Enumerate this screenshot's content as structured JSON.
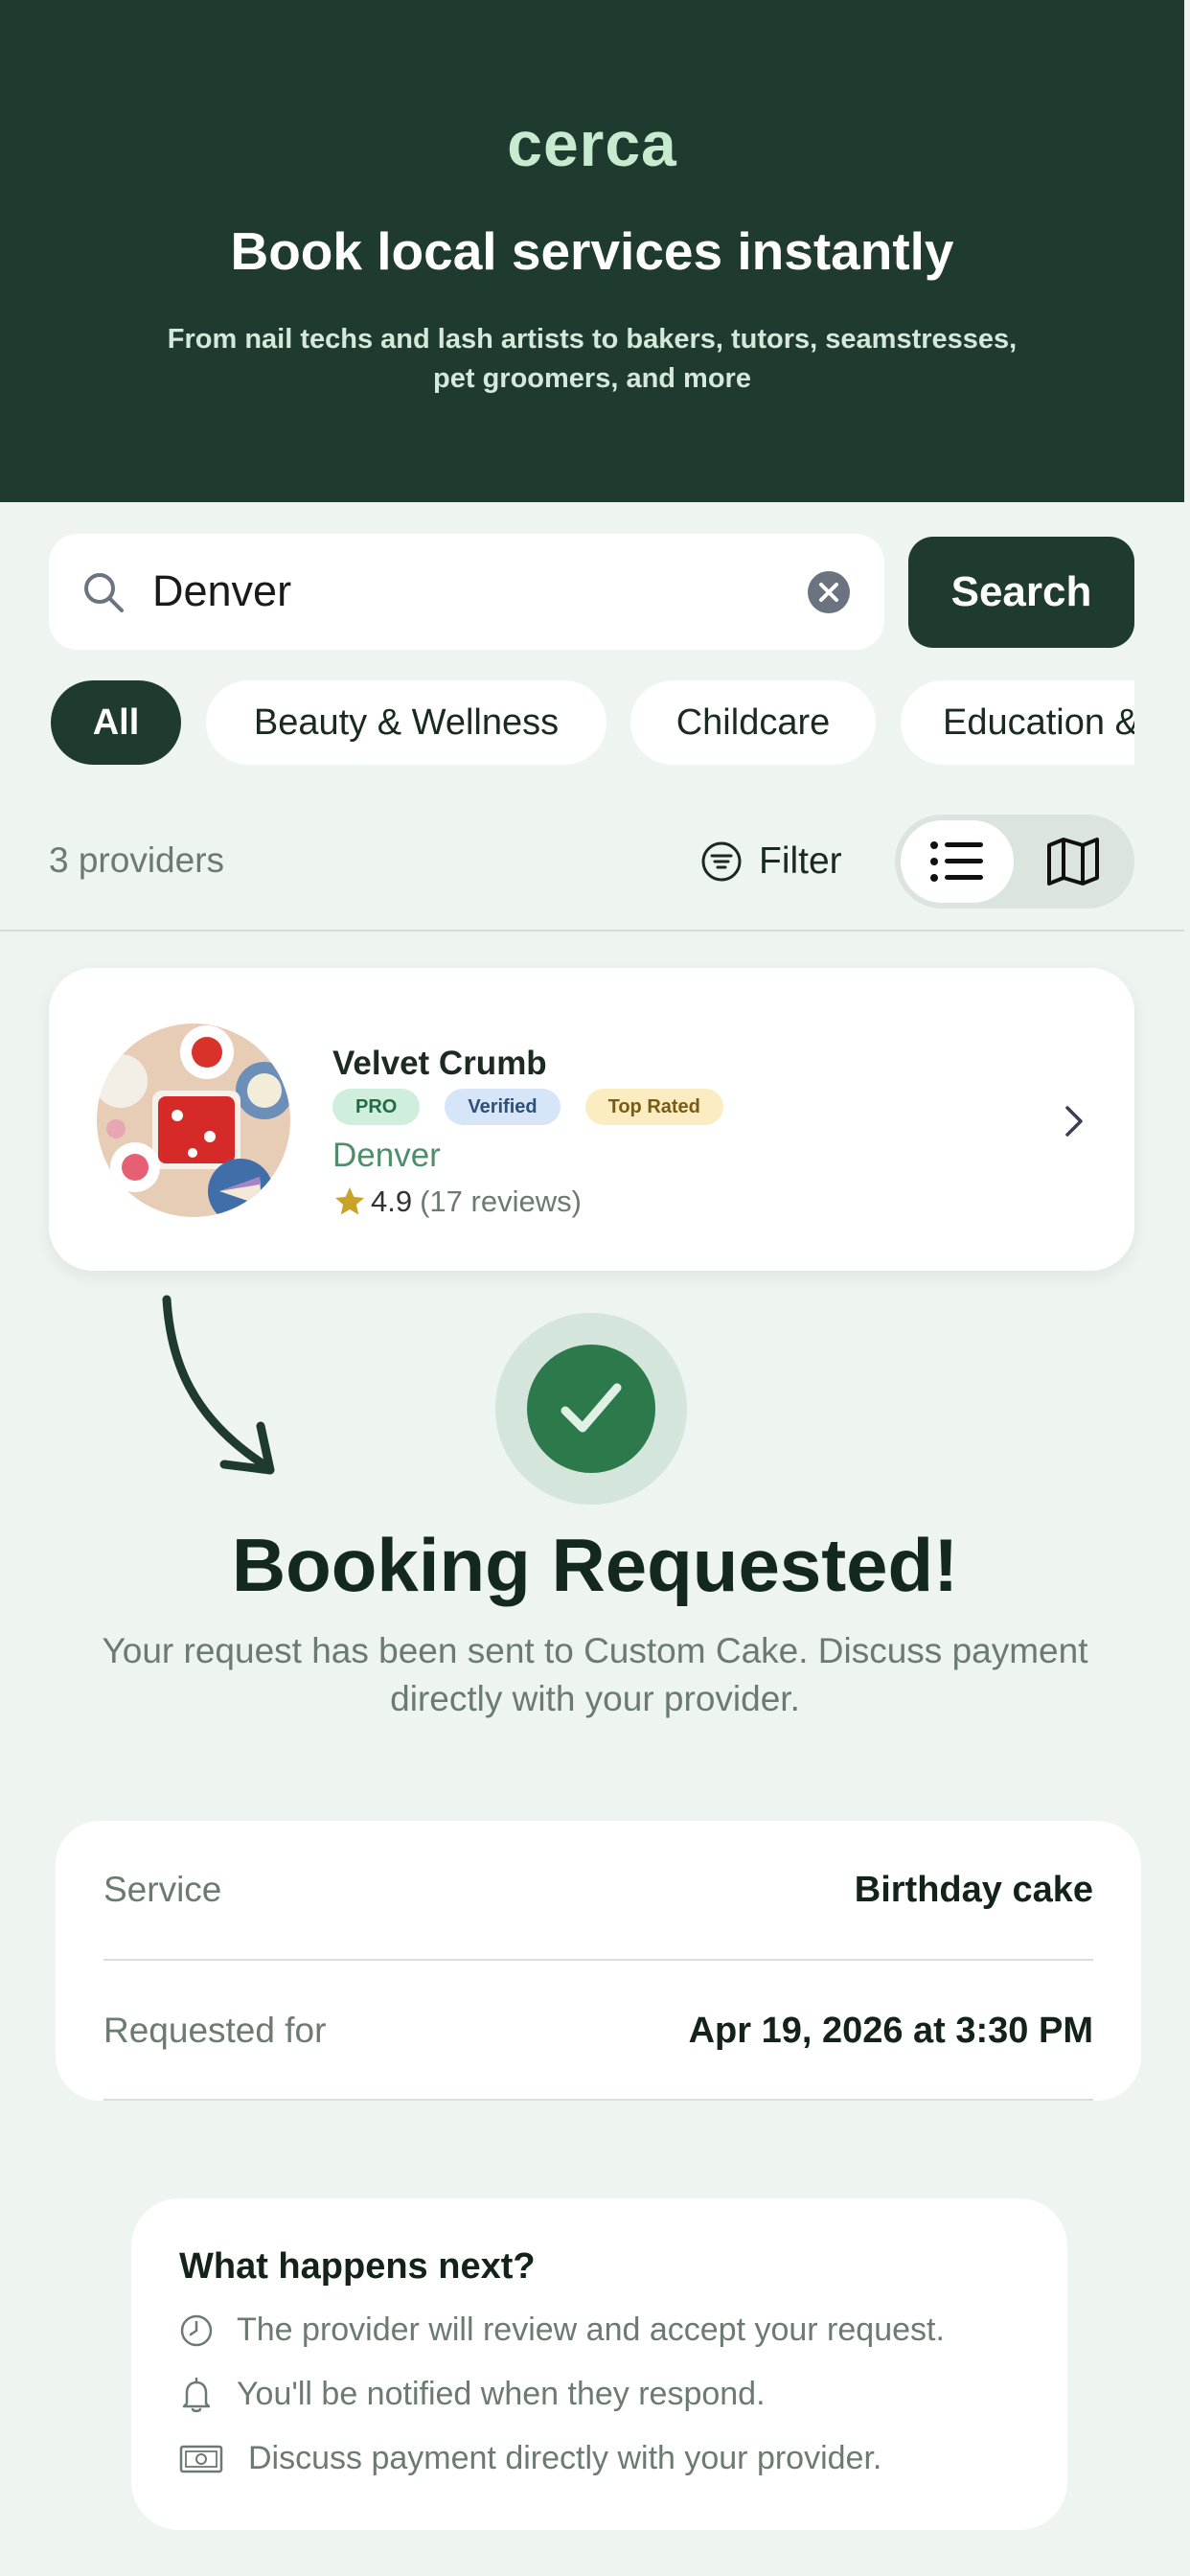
{
  "hero": {
    "brand": "cerca",
    "title": "Book local services instantly",
    "subtitle": "From nail techs and lash artists to bakers, tutors, seamstresses, pet groomers, and more"
  },
  "search": {
    "value": "Denver",
    "button_label": "Search"
  },
  "categories": [
    "All",
    "Beauty & Wellness",
    "Childcare",
    "Education &"
  ],
  "toolbar": {
    "count_label": "3 providers",
    "filter_label": "Filter",
    "view_modes": [
      "list-icon",
      "map-icon"
    ],
    "active_view": "list"
  },
  "provider": {
    "name": "Velvet Crumb",
    "badges": [
      "PRO",
      "Verified",
      "Top Rated"
    ],
    "city": "Denver",
    "rating": "4.9",
    "reviews": "(17 reviews)"
  },
  "confirmation": {
    "title": "Booking Requested!",
    "message": "Your request has been sent to Custom Cake. Discuss payment directly with your provider."
  },
  "details": {
    "service_label": "Service",
    "service_value": "Birthday cake",
    "requested_label": "Requested for",
    "requested_value": "Apr 19, 2026 at 3:30 PM"
  },
  "next_steps": {
    "title": "What happens next?",
    "items": [
      {
        "icon": "clock-icon",
        "text": "The provider will review and accept your request."
      },
      {
        "icon": "bell-icon",
        "text": "You'll be notified when they respond."
      },
      {
        "icon": "cash-icon",
        "text": "Discuss payment directly with your provider."
      }
    ]
  },
  "colors": {
    "primary": "#1f3a2f",
    "background": "#eef4ef",
    "success": "#2c7a4c",
    "brand_tint": "#c8ebcf",
    "star": "#c9a227"
  }
}
